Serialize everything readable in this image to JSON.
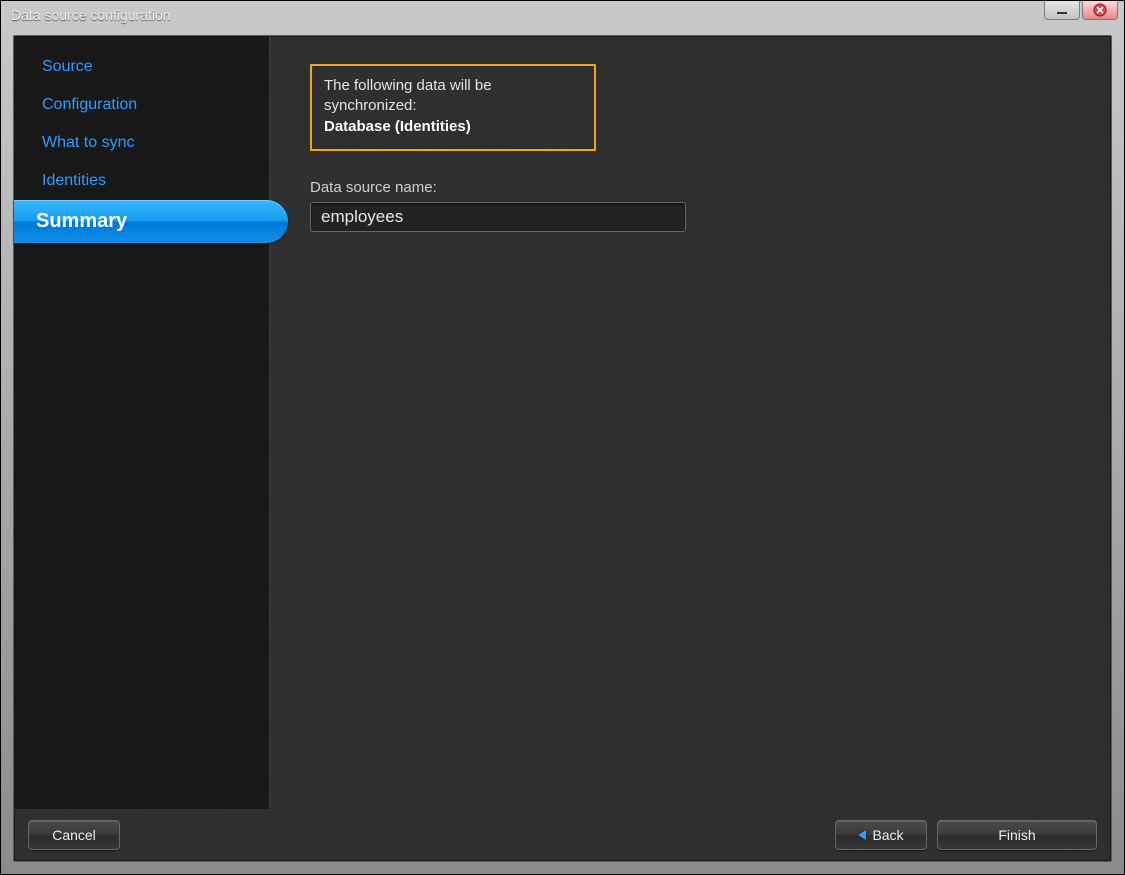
{
  "window": {
    "title": "Data source configuration"
  },
  "sidebar": {
    "items": [
      {
        "label": "Source"
      },
      {
        "label": "Configuration"
      },
      {
        "label": "What to sync"
      },
      {
        "label": "Identities"
      },
      {
        "label": "Summary"
      }
    ],
    "active_index": 4
  },
  "summary": {
    "sync_intro": "The following data will be synchronized:",
    "sync_target": "Database (Identities)",
    "name_label": "Data source name:",
    "name_value": "employees"
  },
  "footer": {
    "cancel": "Cancel",
    "back": "Back",
    "finish": "Finish"
  },
  "colors": {
    "highlight_border": "#f0a61e",
    "accent": "#0f8fe8",
    "link": "#2e9cff"
  }
}
